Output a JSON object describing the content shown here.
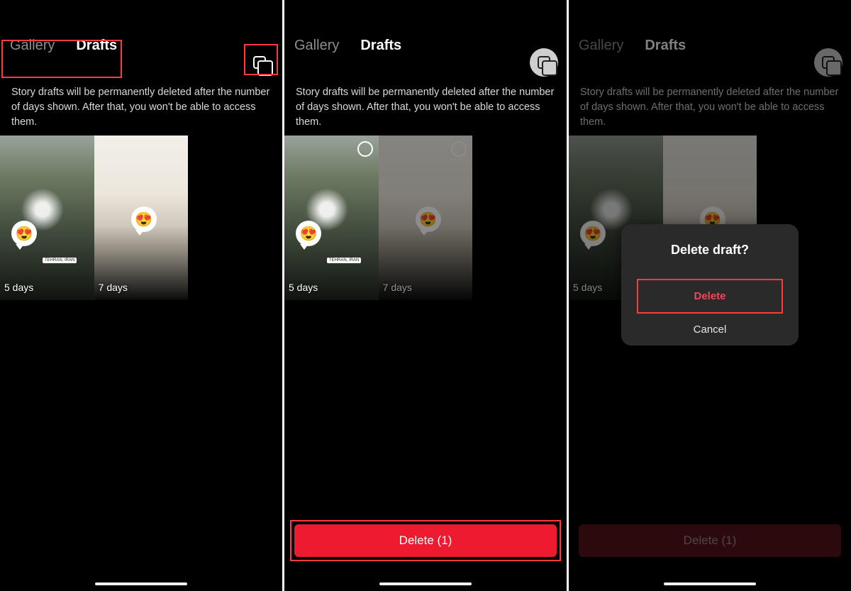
{
  "tabs": {
    "gallery": "Gallery",
    "drafts": "Drafts"
  },
  "info_text": "Story drafts will be permanently deleted after the number of days shown. After that, you won't be able to access them.",
  "drafts": [
    {
      "expiry": "5 days",
      "emoji": "😍",
      "location": "TEHRAN, IRAN"
    },
    {
      "expiry": "7 days",
      "emoji": "😍"
    }
  ],
  "delete_button": "Delete (1)",
  "modal": {
    "title": "Delete draft?",
    "delete": "Delete",
    "cancel": "Cancel"
  }
}
